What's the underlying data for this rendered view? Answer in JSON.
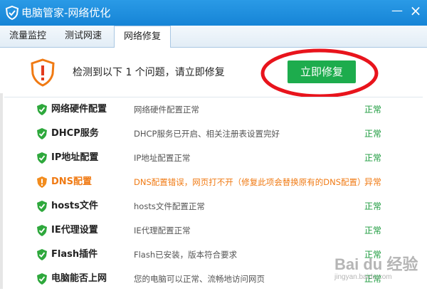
{
  "window": {
    "title": "电脑管家-网络优化",
    "minimize": "—",
    "close": "×"
  },
  "tabs": [
    {
      "label": "流量监控"
    },
    {
      "label": "测试网速"
    },
    {
      "label": "网络修复"
    }
  ],
  "header": {
    "message": "检测到以下 1 个问题，请立即修复",
    "fix_button": "立即修复"
  },
  "items": [
    {
      "name": "网络硬件配置",
      "desc": "网络硬件配置正常",
      "status": "正常",
      "state": "ok"
    },
    {
      "name": "DHCP服务",
      "desc": "DHCP服务已开启、相关注册表设置完好",
      "status": "正常",
      "state": "ok"
    },
    {
      "name": "IP地址配置",
      "desc": "IP地址配置正常",
      "status": "正常",
      "state": "ok"
    },
    {
      "name": "DNS配置",
      "desc": "DNS配置错误，网页打不开（修复此项会替换原有的DNS配置）",
      "status": "异常",
      "state": "warn"
    },
    {
      "name": "hosts文件",
      "desc": "hosts文件配置正常",
      "status": "正常",
      "state": "ok"
    },
    {
      "name": "IE代理设置",
      "desc": "IE代理配置正常",
      "status": "正常",
      "state": "ok"
    },
    {
      "name": "Flash插件",
      "desc": "Flash已安装，版本符合要求",
      "status": "正常",
      "state": "ok"
    },
    {
      "name": "电脑能否上网",
      "desc": "您的电脑可以正常、流畅地访问网页",
      "status": "正常",
      "state": "ok"
    }
  ],
  "watermark": {
    "main": "Bai du 经验",
    "sub": "jingyan.baidu.com"
  },
  "colors": {
    "titlebar": "#1684d6",
    "ok": "#1c9b3e",
    "warn": "#f07a13",
    "fix_button": "#1dac4d",
    "highlight_ellipse": "#e8141c"
  },
  "icons": {
    "app": "shield-check-icon",
    "header": "warning-shield-icon",
    "ok": "green-check-shield-icon",
    "warn": "orange-exclamation-shield-icon"
  }
}
